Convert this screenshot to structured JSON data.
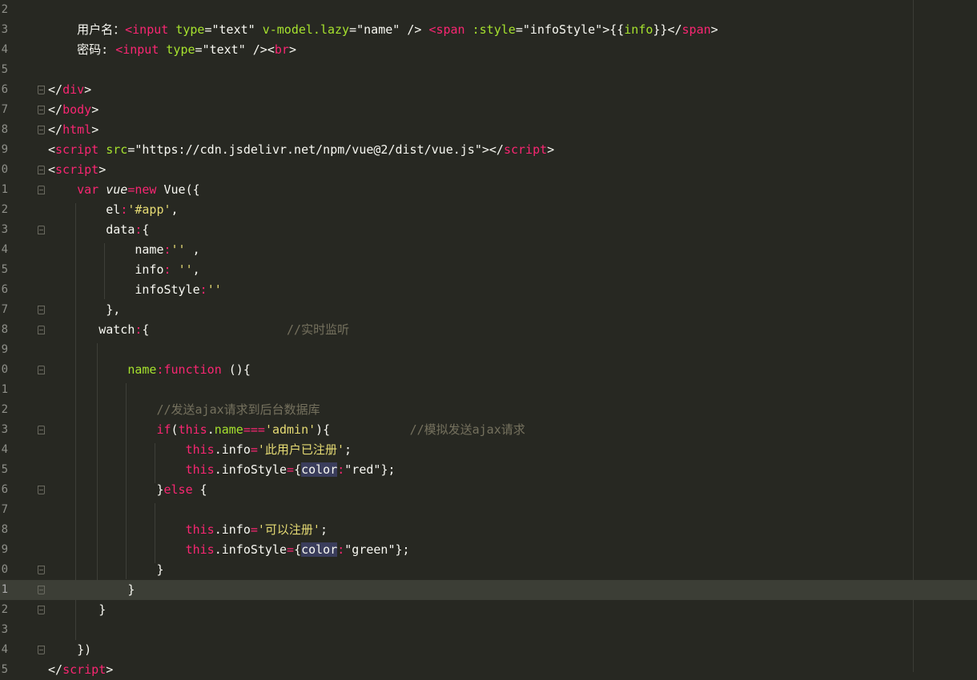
{
  "editor": {
    "current_line": 29,
    "lines": [
      {
        "n": "2",
        "segs": []
      },
      {
        "n": "3",
        "fold": "",
        "segs": [
          [
            "t-punc",
            "    用户名："
          ],
          [
            "t-tag",
            "<input"
          ],
          [
            "t-punc",
            " "
          ],
          [
            "t-attr",
            "type"
          ],
          [
            "t-punc",
            "="
          ],
          [
            "t-str-w",
            "\"text\""
          ],
          [
            "t-punc",
            " "
          ],
          [
            "t-attr",
            "v-model.lazy"
          ],
          [
            "t-punc",
            "="
          ],
          [
            "t-str-w",
            "\"name\""
          ],
          [
            "t-punc",
            " /> "
          ],
          [
            "t-tag",
            "<span"
          ],
          [
            "t-punc",
            " "
          ],
          [
            "t-attr",
            ":style"
          ],
          [
            "t-punc",
            "="
          ],
          [
            "t-str-w",
            "\"infoStyle\""
          ],
          [
            "t-punc",
            ">{{"
          ],
          [
            "t-attr",
            "info"
          ],
          [
            "t-punc",
            "}}</"
          ],
          [
            "t-tag",
            "span"
          ],
          [
            "t-punc",
            ">"
          ]
        ]
      },
      {
        "n": "4",
        "segs": [
          [
            "t-punc",
            "    密码: "
          ],
          [
            "t-tag",
            "<input"
          ],
          [
            "t-punc",
            " "
          ],
          [
            "t-attr",
            "type"
          ],
          [
            "t-punc",
            "="
          ],
          [
            "t-str-w",
            "\"text\""
          ],
          [
            "t-punc",
            " /><"
          ],
          [
            "t-tag",
            "br"
          ],
          [
            "t-punc",
            ">"
          ]
        ]
      },
      {
        "n": "5",
        "segs": []
      },
      {
        "n": "6",
        "fold": "end",
        "segs": [
          [
            "t-punc",
            "</"
          ],
          [
            "t-tag",
            "div"
          ],
          [
            "t-punc",
            ">"
          ]
        ]
      },
      {
        "n": "7",
        "fold": "end",
        "segs": [
          [
            "t-punc",
            "</"
          ],
          [
            "t-tag",
            "body"
          ],
          [
            "t-punc",
            ">"
          ]
        ]
      },
      {
        "n": "8",
        "fold": "end",
        "segs": [
          [
            "t-punc",
            "</"
          ],
          [
            "t-tag",
            "html"
          ],
          [
            "t-punc",
            ">"
          ]
        ]
      },
      {
        "n": "9",
        "segs": [
          [
            "t-punc",
            "<"
          ],
          [
            "t-tag",
            "script"
          ],
          [
            "t-punc",
            " "
          ],
          [
            "t-attr",
            "src"
          ],
          [
            "t-punc",
            "="
          ],
          [
            "t-str-w",
            "\"https://cdn.jsdelivr.net/npm/vue@2/dist/vue.js\""
          ],
          [
            "t-punc",
            "></"
          ],
          [
            "t-tag",
            "script"
          ],
          [
            "t-punc",
            ">"
          ]
        ]
      },
      {
        "n": "0",
        "fold": "open",
        "segs": [
          [
            "t-punc",
            "<"
          ],
          [
            "t-tag",
            "script"
          ],
          [
            "t-punc",
            ">"
          ]
        ]
      },
      {
        "n": "1",
        "fold": "open",
        "segs": [
          [
            "t-punc",
            "    "
          ],
          [
            "t-kw",
            "var"
          ],
          [
            "t-punc",
            " "
          ],
          [
            "t-var",
            "vue"
          ],
          [
            "t-op",
            "="
          ],
          [
            "t-kw",
            "new"
          ],
          [
            "t-punc",
            " Vue({"
          ]
        ]
      },
      {
        "n": "2",
        "segs": [
          [
            "t-punc",
            "        el"
          ],
          [
            "t-op",
            ":"
          ],
          [
            "t-str",
            "'#app'"
          ],
          [
            "t-punc",
            ","
          ]
        ]
      },
      {
        "n": "3",
        "fold": "open",
        "segs": [
          [
            "t-punc",
            "        data"
          ],
          [
            "t-op",
            ":"
          ],
          [
            "t-punc",
            "{"
          ]
        ]
      },
      {
        "n": "4",
        "segs": [
          [
            "t-punc",
            "            name"
          ],
          [
            "t-op",
            ":"
          ],
          [
            "t-str",
            "''"
          ],
          [
            "t-punc",
            " ,"
          ]
        ]
      },
      {
        "n": "5",
        "segs": [
          [
            "t-punc",
            "            info"
          ],
          [
            "t-op",
            ":"
          ],
          [
            "t-punc",
            " "
          ],
          [
            "t-str",
            "''"
          ],
          [
            "t-punc",
            ","
          ]
        ]
      },
      {
        "n": "6",
        "segs": [
          [
            "t-punc",
            "            infoStyle"
          ],
          [
            "t-op",
            ":"
          ],
          [
            "t-str",
            "''"
          ]
        ]
      },
      {
        "n": "7",
        "fold": "end",
        "segs": [
          [
            "t-punc",
            "        },"
          ]
        ]
      },
      {
        "n": "8",
        "fold": "open",
        "segs": [
          [
            "t-punc",
            "       watch"
          ],
          [
            "t-op",
            ":"
          ],
          [
            "t-punc",
            "{                   "
          ],
          [
            "t-comment",
            "//实时监听"
          ]
        ]
      },
      {
        "n": "9",
        "segs": []
      },
      {
        "n": "0",
        "fold": "open",
        "segs": [
          [
            "t-punc",
            "           "
          ],
          [
            "t-fn-name",
            "name"
          ],
          [
            "t-op",
            ":"
          ],
          [
            "t-kw",
            "function"
          ],
          [
            "t-punc",
            " (){"
          ]
        ]
      },
      {
        "n": "1",
        "segs": []
      },
      {
        "n": "2",
        "segs": [
          [
            "t-punc",
            "               "
          ],
          [
            "t-comment",
            "//发送ajax请求到后台数据库"
          ]
        ]
      },
      {
        "n": "3",
        "fold": "open",
        "segs": [
          [
            "t-punc",
            "               "
          ],
          [
            "t-kw",
            "if"
          ],
          [
            "t-punc",
            "("
          ],
          [
            "t-this",
            "this"
          ],
          [
            "t-punc",
            "."
          ],
          [
            "t-attr",
            "name"
          ],
          [
            "t-op",
            "==="
          ],
          [
            "t-str",
            "'admin'"
          ],
          [
            "t-punc",
            "){           "
          ],
          [
            "t-comment",
            "//模拟发送ajax请求"
          ]
        ]
      },
      {
        "n": "4",
        "segs": [
          [
            "t-punc",
            "                   "
          ],
          [
            "t-this",
            "this"
          ],
          [
            "t-punc",
            ".info"
          ],
          [
            "t-op",
            "="
          ],
          [
            "t-str",
            "'此用户已注册'"
          ],
          [
            "t-punc",
            ";"
          ]
        ]
      },
      {
        "n": "5",
        "segs": [
          [
            "t-punc",
            "                   "
          ],
          [
            "t-this",
            "this"
          ],
          [
            "t-punc",
            ".infoStyle"
          ],
          [
            "t-op",
            "="
          ],
          [
            "t-punc",
            "{"
          ],
          [
            "t-hl",
            "color"
          ],
          [
            "t-op",
            ":"
          ],
          [
            "t-str-w",
            "\"red\""
          ],
          [
            "t-punc",
            "};"
          ]
        ]
      },
      {
        "n": "6",
        "fold": "end",
        "segs": [
          [
            "t-punc",
            "               }"
          ],
          [
            "t-kw",
            "else"
          ],
          [
            "t-punc",
            " {"
          ]
        ]
      },
      {
        "n": "7",
        "segs": []
      },
      {
        "n": "8",
        "segs": [
          [
            "t-punc",
            "                   "
          ],
          [
            "t-this",
            "this"
          ],
          [
            "t-punc",
            ".info"
          ],
          [
            "t-op",
            "="
          ],
          [
            "t-str",
            "'可以注册'"
          ],
          [
            "t-punc",
            ";"
          ]
        ]
      },
      {
        "n": "9",
        "segs": [
          [
            "t-punc",
            "                   "
          ],
          [
            "t-this",
            "this"
          ],
          [
            "t-punc",
            ".infoStyle"
          ],
          [
            "t-op",
            "="
          ],
          [
            "t-punc",
            "{"
          ],
          [
            "t-hl",
            "color"
          ],
          [
            "t-op",
            ":"
          ],
          [
            "t-str-w",
            "\"green\""
          ],
          [
            "t-punc",
            "};"
          ]
        ]
      },
      {
        "n": "0",
        "fold": "end",
        "segs": [
          [
            "t-punc",
            "               }"
          ]
        ]
      },
      {
        "n": "1",
        "fold": "end",
        "segs": [
          [
            "t-punc",
            "           }"
          ]
        ]
      },
      {
        "n": "2",
        "fold": "end",
        "segs": [
          [
            "t-punc",
            "       }"
          ]
        ]
      },
      {
        "n": "3",
        "segs": []
      },
      {
        "n": "4",
        "fold": "end",
        "segs": [
          [
            "t-punc",
            "    })"
          ]
        ]
      },
      {
        "n": "5",
        "segs": [
          [
            "t-punc",
            "</"
          ],
          [
            "t-tag",
            "script"
          ],
          [
            "t-punc",
            ">"
          ]
        ]
      }
    ]
  },
  "colors": {
    "background": "#272822",
    "current_line": "#3c3e36",
    "tag": "#f92672",
    "attr": "#a6e22e",
    "string": "#e6db74",
    "comment": "#75715e"
  }
}
